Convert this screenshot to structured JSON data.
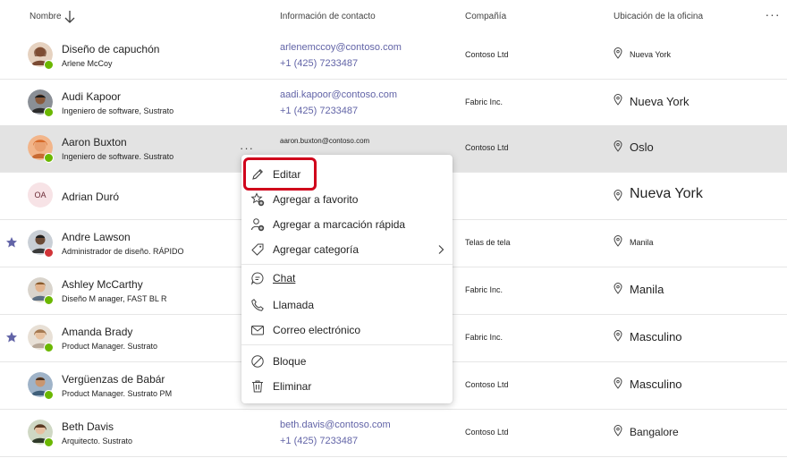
{
  "header": {
    "col_name": "Nombre",
    "col_contact": "Información de contacto",
    "col_company": "Compañía",
    "col_office": "Ubicación de la oficina",
    "sort_icon": "arrow-down-icon",
    "more_icon": "more-horizontal-icon",
    "more_label": "···"
  },
  "rows": [
    {
      "name": "Diseño de capuchón",
      "title": "Arlene McCoy",
      "email": "arlenemccoy@contoso.com",
      "phone": "+1 (425) 7233487",
      "company": "Contoso Ltd",
      "office": "Nueva York",
      "presence": "available"
    },
    {
      "name": "Audi Kapoor",
      "title": "Ingeniero de software, Sustrato",
      "email": "aadi.kapoor@contoso.com",
      "phone": "+1 (425) 7233487",
      "company": "Fabric Inc.",
      "office": "Nueva York",
      "presence": "available"
    },
    {
      "name": "Aaron Buxton",
      "title": "Ingeniero de software. Sustrato",
      "email": "aaron.buxton@contoso.com",
      "phone": "",
      "company": "Contoso Ltd",
      "office": "Oslo",
      "presence": "available",
      "selected": true,
      "more_label": "···"
    },
    {
      "name": "Adrian Duró",
      "initials": "OA",
      "title": "",
      "email": "",
      "phone": "",
      "company": "",
      "office": "Nueva York"
    },
    {
      "name": "Andre Lawson",
      "title": "Administrador de diseño. RÁPIDO",
      "email": "",
      "phone": "",
      "company": "Telas de tela",
      "office": "Manila",
      "presence": "busy",
      "favorite": true
    },
    {
      "name": "Ashley McCarthy",
      "title": "Diseño M  anager, FAST BL R",
      "email": "",
      "phone": "",
      "company": "Fabric Inc.",
      "office": "Manila",
      "presence": "available"
    },
    {
      "name": "Amanda Brady",
      "title": "Product Manager. Sustrato",
      "email": "",
      "phone": "",
      "company": "Fabric Inc.",
      "office": "Masculino",
      "presence": "available",
      "favorite": true
    },
    {
      "name": "Vergüenzas de Babár",
      "title": "Product Manager. Sustrato PM",
      "email": "",
      "phone": "",
      "company": "Contoso Ltd",
      "office": "Masculino",
      "presence": "available"
    },
    {
      "name": "Beth Davis",
      "title": "Arquitecto. Sustrato",
      "email": "beth.davis@contoso.com",
      "phone": "+1 (425) 7233487",
      "company": "Contoso Ltd",
      "office": "Bangalore",
      "presence": "available"
    }
  ],
  "context_menu": {
    "items": [
      {
        "label": "Editar",
        "icon": "pencil-icon"
      },
      {
        "label": "Agregar a favorito",
        "icon": "star-add-icon"
      },
      {
        "label": "Agregar a marcación rápida",
        "icon": "person-add-icon"
      },
      {
        "label": "Agregar categoría",
        "icon": "tag-icon",
        "submenu": true
      },
      {
        "label": "Chat",
        "icon": "chat-icon"
      },
      {
        "label": "Llamada",
        "icon": "phone-icon"
      },
      {
        "label": "Correo electrónico",
        "icon": "mail-icon"
      },
      {
        "label": "Bloque",
        "icon": "block-icon"
      },
      {
        "label": "Eliminar",
        "icon": "trash-icon"
      }
    ]
  },
  "colors": {
    "accent": "#6264a7",
    "available": "#6bb700",
    "busy": "#d13438",
    "favorite": "#6264a7",
    "highlight": "#d0021b"
  }
}
